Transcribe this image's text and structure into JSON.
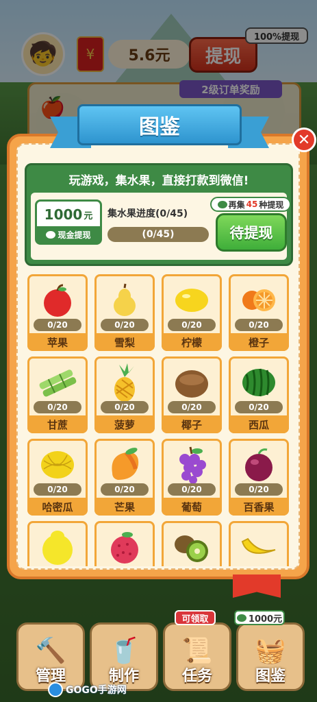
{
  "top_bar": {
    "balance": "5.6元",
    "withdraw_label": "提现",
    "withdraw_tip": "100%提现"
  },
  "order_card": {
    "tag": "2级订单奖励"
  },
  "modal": {
    "title": "图鉴",
    "close_icon": "close-icon",
    "info": {
      "headline": "玩游戏，集水果，直接打款到微信!",
      "cash_amount": "1000",
      "cash_unit": "元",
      "cash_label": "现金提现",
      "progress_title": "集水果进度(0/45)",
      "progress_text": "(0/45)",
      "progress_value": 0,
      "progress_total": 45,
      "collect_prefix": "再集",
      "collect_count": "45",
      "collect_suffix": "种提现",
      "pending_label": "待提现"
    },
    "fruits": [
      {
        "name": "苹果",
        "count": "0/20",
        "icon": "apple-icon"
      },
      {
        "name": "雪梨",
        "count": "0/20",
        "icon": "pear-icon"
      },
      {
        "name": "柠檬",
        "count": "0/20",
        "icon": "lemon-icon"
      },
      {
        "name": "橙子",
        "count": "0/20",
        "icon": "orange-icon"
      },
      {
        "name": "甘蔗",
        "count": "0/20",
        "icon": "sugarcane-icon"
      },
      {
        "name": "菠萝",
        "count": "0/20",
        "icon": "pineapple-icon"
      },
      {
        "name": "椰子",
        "count": "0/20",
        "icon": "coconut-icon"
      },
      {
        "name": "西瓜",
        "count": "0/20",
        "icon": "watermelon-icon"
      },
      {
        "name": "哈密瓜",
        "count": "0/20",
        "icon": "cantaloupe-icon"
      },
      {
        "name": "芒果",
        "count": "0/20",
        "icon": "mango-icon"
      },
      {
        "name": "葡萄",
        "count": "0/20",
        "icon": "grape-icon"
      },
      {
        "name": "百香果",
        "count": "0/20",
        "icon": "passionfruit-icon"
      },
      {
        "name": "",
        "count": "",
        "icon": "pomelo-icon"
      },
      {
        "name": "",
        "count": "",
        "icon": "lychee-icon"
      },
      {
        "name": "",
        "count": "",
        "icon": "kiwi-icon"
      },
      {
        "name": "",
        "count": "",
        "icon": "banana-icon"
      }
    ]
  },
  "bottom_nav": {
    "items": [
      {
        "label": "管理",
        "icon": "manage-icon"
      },
      {
        "label": "制作",
        "icon": "make-juice-icon"
      },
      {
        "label": "任务",
        "icon": "task-scroll-icon"
      },
      {
        "label": "图鉴",
        "icon": "fruit-basket-icon"
      }
    ],
    "claim_badge": "可领取",
    "cash_badge": "1000元"
  },
  "watermark": {
    "text": "GOGO手游网"
  }
}
